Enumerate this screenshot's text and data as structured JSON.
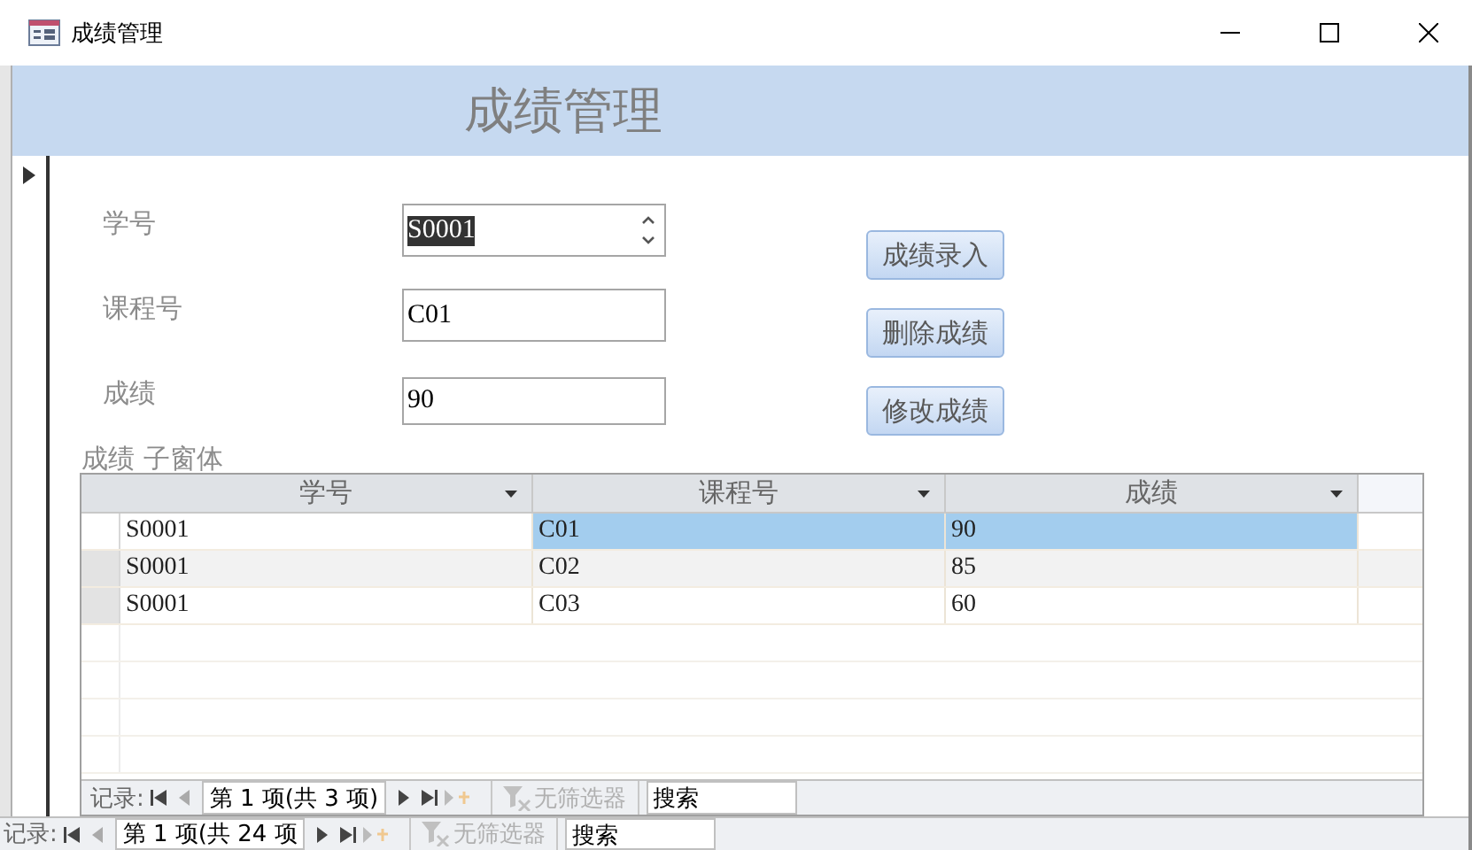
{
  "window": {
    "title": "成绩管理"
  },
  "header": {
    "title": "成绩管理"
  },
  "form": {
    "fields": [
      {
        "label": "学号",
        "value": "S0001",
        "kind": "spin",
        "selected_text": true
      },
      {
        "label": "课程号",
        "value": "C01",
        "kind": "text",
        "selected_text": false
      },
      {
        "label": "成绩",
        "value": "90",
        "kind": "text",
        "selected_text": false
      }
    ],
    "buttons": [
      "成绩录入",
      "删除成绩",
      "修改成绩"
    ]
  },
  "subform": {
    "label": "成绩 子窗体",
    "columns": [
      "学号",
      "课程号",
      "成绩"
    ],
    "rows": [
      {
        "selected": true,
        "cells": [
          {
            "text": "S0001",
            "highlighted": false
          },
          {
            "text": "C01",
            "highlighted": true
          },
          {
            "text": "90",
            "highlighted": true
          }
        ]
      },
      {
        "selected": false,
        "cells": [
          {
            "text": "S0001",
            "highlighted": false
          },
          {
            "text": "C02",
            "highlighted": false
          },
          {
            "text": "85",
            "highlighted": false
          }
        ]
      },
      {
        "selected": false,
        "cells": [
          {
            "text": "S0001",
            "highlighted": false
          },
          {
            "text": "C03",
            "highlighted": false
          },
          {
            "text": "60",
            "highlighted": false
          }
        ]
      }
    ],
    "navigator": {
      "label": "记录:",
      "position": "第 1 项(共 3 项)",
      "filter": "无筛选器",
      "filter_disabled": true,
      "search_placeholder": "搜索"
    }
  },
  "navigator": {
    "label": "记录:",
    "position": "第 1 项(共 24 项",
    "filter": "无筛选器",
    "filter_disabled": true,
    "search_placeholder": "搜索"
  }
}
